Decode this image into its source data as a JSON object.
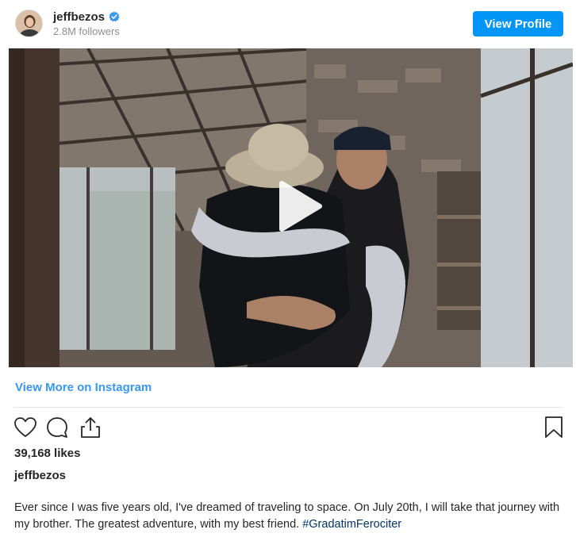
{
  "header": {
    "username": "jeffbezos",
    "followers": "2.8M followers",
    "view_profile_label": "View Profile"
  },
  "media": {
    "type": "video",
    "play_icon": "play-icon"
  },
  "view_more_label": "View More on Instagram",
  "actions": {
    "like_icon": "heart-icon",
    "comment_icon": "comment-icon",
    "share_icon": "share-icon",
    "save_icon": "bookmark-icon"
  },
  "likes": "39,168 likes",
  "post": {
    "author": "jeffbezos",
    "caption_text": "Ever since I was five years old, I've dreamed of traveling to space. On July 20th, I will take that journey with my brother. The greatest adventure, with my best friend. ",
    "hashtag": "#GradatimFerociter"
  },
  "colors": {
    "accent": "#0095f6",
    "link": "#3897f0",
    "verified": "#3897f0"
  }
}
